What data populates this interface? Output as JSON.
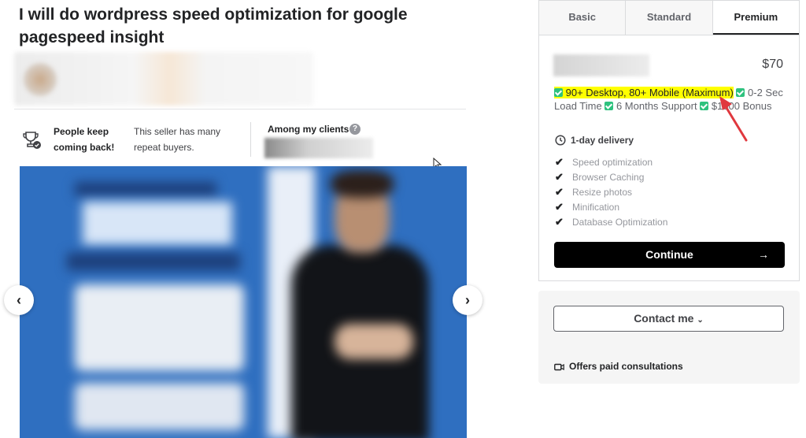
{
  "gig": {
    "title": "I will do wordpress speed optimization for google pagespeed insight"
  },
  "highlights": {
    "keep_coming": "People keep coming back!",
    "repeat_buyers": "This seller has many repeat buyers.",
    "clients_label": "Among my clients",
    "help_glyph": "?"
  },
  "gallery": {
    "prev_glyph": "‹",
    "next_glyph": "›"
  },
  "package": {
    "tabs": [
      {
        "label": "Basic"
      },
      {
        "label": "Standard"
      },
      {
        "label": "Premium"
      }
    ],
    "active_tab": "Premium",
    "price": "$70",
    "description": {
      "highlighted": "90+ Desktop, 80+ Mobile (Maximum)",
      "part2": "0-2 Sec Load Time",
      "part3": "6 Months Support",
      "part4": "$1500 Bonus"
    },
    "delivery": "1-day delivery",
    "features": [
      "Speed optimization",
      "Browser Caching",
      "Resize photos",
      "Minification",
      "Database Optimization"
    ],
    "continue_label": "Continue",
    "continue_arrow": "→"
  },
  "contact": {
    "contact_label": "Contact me",
    "paid_consult": "Offers paid consultations"
  },
  "colors": {
    "highlight": "#ffff00",
    "check_green": "#2ec27e",
    "arrow_red": "#e0383e",
    "button_black": "#000000"
  }
}
